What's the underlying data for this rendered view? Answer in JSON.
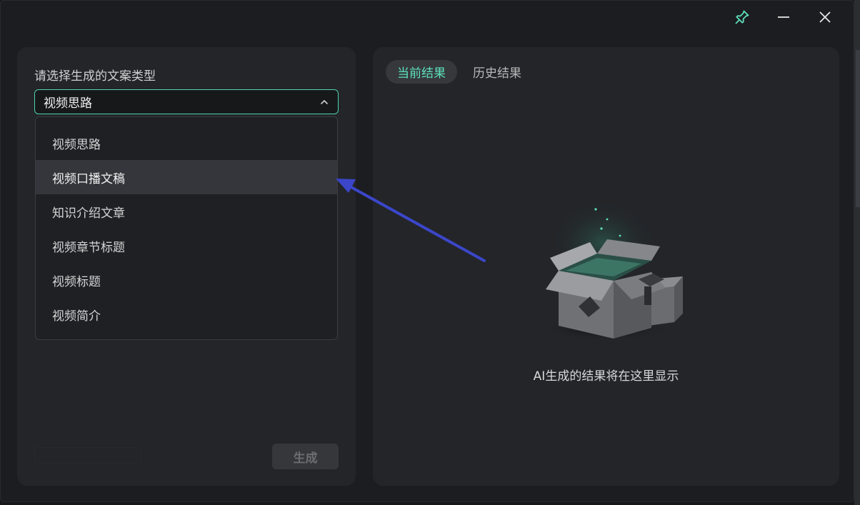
{
  "window": {
    "controls": [
      {
        "name": "pin-button",
        "icon": "pin-icon"
      },
      {
        "name": "minimize-button",
        "icon": "minimize-icon"
      },
      {
        "name": "close-button",
        "icon": "close-icon"
      }
    ]
  },
  "left": {
    "label": "请选择生成的文案类型",
    "selected": "视频思路",
    "options": [
      "视频思路",
      "视频口播文稿",
      "知识介绍文章",
      "视频章节标题",
      "视频标题",
      "视频简介"
    ],
    "hovered_index": 1,
    "generate_label": "生成"
  },
  "right": {
    "tabs": [
      {
        "label": "当前结果",
        "active": true
      },
      {
        "label": "历史结果",
        "active": false
      }
    ],
    "empty_message": "AI生成的结果将在这里显示"
  },
  "colors": {
    "accent": "#5de0bd",
    "border_accent": "#4fd1b0",
    "panel": "#232529",
    "annotation_arrow": "#3b46c9"
  }
}
